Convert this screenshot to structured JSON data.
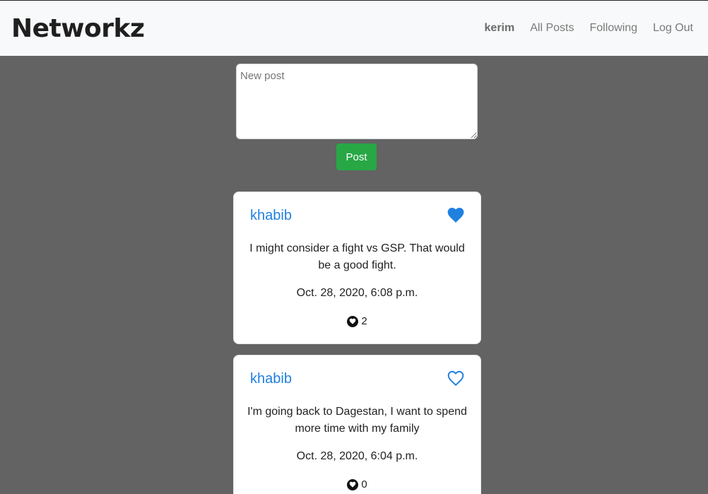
{
  "navbar": {
    "brand": "Networkz",
    "links": [
      {
        "label": "kerim"
      },
      {
        "label": "All Posts"
      },
      {
        "label": "Following"
      },
      {
        "label": "Log Out"
      }
    ]
  },
  "compose": {
    "placeholder": "New post",
    "value": "",
    "submit_label": "Post"
  },
  "posts": [
    {
      "author": "khabib",
      "content": "I might consider a fight vs GSP. That would be a good fight.",
      "timestamp": "Oct. 28, 2020, 6:08 p.m.",
      "likes": "2",
      "liked": true,
      "heart_icon": "heart-filled-icon"
    },
    {
      "author": "khabib",
      "content": "I'm going back to Dagestan, I want to spend more time with my family",
      "timestamp": "Oct. 28, 2020, 6:04 p.m.",
      "likes": "0",
      "liked": false,
      "heart_icon": "heart-outline-icon"
    }
  ],
  "colors": {
    "background": "#636363",
    "navbar": "#f8f9fa",
    "accent": "#1f80e0",
    "post_button": "#28a745"
  }
}
